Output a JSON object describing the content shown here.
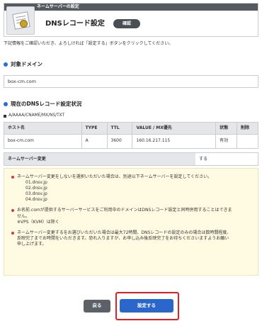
{
  "header": {
    "bar_label": "ネームサーバーの設定",
    "title": "DNSレコード設定",
    "badge": "確認"
  },
  "intro": "下記情報をご確認いただき、よろしければ「設定する」ボタンをクリックしてください。",
  "target_domain": {
    "heading": "対象ドメイン",
    "value": "box-cm.com"
  },
  "records": {
    "heading": "現在のDNSレコード設定状況",
    "types": "A/AAAA/CNAME/MX/NS/TXT",
    "columns": [
      "ホスト名",
      "TYPE",
      "TTL",
      "VALUE / MX優先",
      "状態",
      "削除"
    ],
    "rows": [
      [
        "box-cm.com",
        "A",
        "3600",
        "160.16.217.115",
        "有効",
        ""
      ]
    ]
  },
  "nameserver_change": {
    "label": "ネームサーバー変更",
    "value": "する"
  },
  "notices": {
    "n1": "ネームサーバー変更をしないを選択いただいた場合は、別途以下ネームサーバーを設定してください。",
    "n1_servers": [
      "01.dnsv.jp",
      "02.dnsv.jp",
      "03.dnsv.jp",
      "04.dnsv.jp"
    ],
    "n2_line1": "お名前.comが提供するサーバーサービスをご利用中のドメインはDNSレコード設定と同時併用することはできま",
    "n2_line2": "せん。",
    "n2_line3": "※VPS（KVM）は除く",
    "n3_line1": "ネームサーバー変更するをお選びいただいた場合は最大72時間、DNSレコードの設定のみの場合は数時間程度、",
    "n3_line2": "反映完了までお時間をいただきます。恐れ入りますが、お申し込み後反映完了をお待ちくださいますようお願い",
    "n3_line3": "申し上げます。"
  },
  "buttons": {
    "back": "戻る",
    "submit": "設定する"
  },
  "colors": {
    "accent_blue": "#2a66cc",
    "highlight_red": "#e02020",
    "notice_bg": "#fffbe3"
  }
}
